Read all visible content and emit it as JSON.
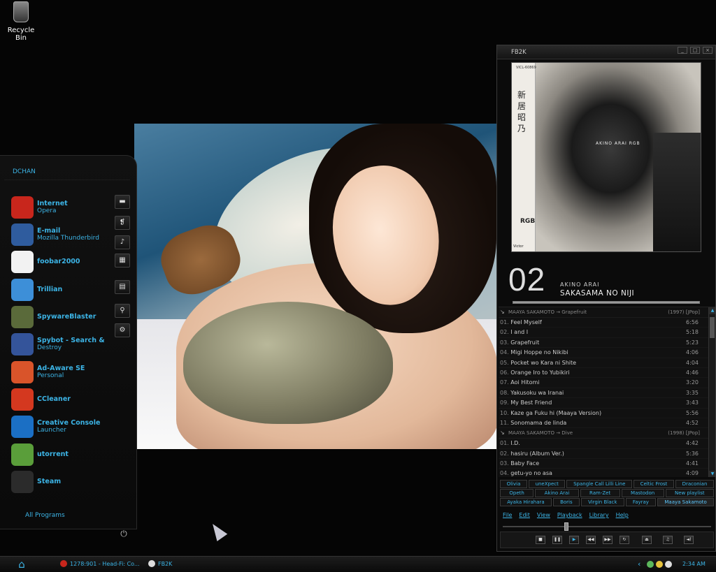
{
  "desktop": {
    "recycle_bin_label": "Recycle Bin",
    "recycle_bin_icon": "recycle-bin-icon"
  },
  "start_menu": {
    "user": "DCHAN",
    "apps": [
      {
        "name": "Internet",
        "sub": "Opera",
        "icon": "opera-icon",
        "color": "#c8261c"
      },
      {
        "name": "E-mail",
        "sub": "Mozilla Thunderbird",
        "icon": "thunderbird-icon",
        "color": "#2f5c9e"
      },
      {
        "name": "foobar2000",
        "sub": "",
        "icon": "foobar2000-icon",
        "color": "#f2f2f2"
      },
      {
        "name": "Trillian",
        "sub": "",
        "icon": "trillian-icon",
        "color": "#3d8fd8"
      },
      {
        "name": "SpywareBlaster",
        "sub": "",
        "icon": "spywareblaster-icon",
        "color": "#5a6a3a"
      },
      {
        "name": "Spybot - Search &",
        "sub": "Destroy",
        "icon": "spybot-icon",
        "color": "#34549a"
      },
      {
        "name": "Ad-Aware SE",
        "sub": "Personal",
        "icon": "adaware-icon",
        "color": "#d9542a"
      },
      {
        "name": "CCleaner",
        "sub": "",
        "icon": "ccleaner-icon",
        "color": "#d4381f"
      },
      {
        "name": "Creative Console",
        "sub": "Launcher",
        "icon": "creative-console-icon",
        "color": "#1b6fc4"
      },
      {
        "name": "utorrent",
        "sub": "",
        "icon": "utorrent-icon",
        "color": "#5a9e3a"
      },
      {
        "name": "Steam",
        "sub": "",
        "icon": "steam-icon",
        "color": "#2b2b2b"
      }
    ],
    "all_programs": "All Programs"
  },
  "fb2k": {
    "window_title": "FB2K",
    "album_art": {
      "catalog": "VICL-60869",
      "kana": "新居昭乃",
      "artist_text": "AKINO ARAI  RGB",
      "rgb": "RGB",
      "label": "Victor"
    },
    "now_playing": {
      "track_number": "02",
      "artist": "AKINO ARAI",
      "title": "SAKASAMA NO NIJI",
      "progress_fraction": 1.0
    },
    "playlist": {
      "groups": [
        {
          "header": "MAAYA SAKAMOTO → Grapefruit",
          "year": "(1997)  [JPop]",
          "tracks": [
            {
              "n": "01.",
              "t": "Feel Myself",
              "d": "6:56"
            },
            {
              "n": "02.",
              "t": "I and I",
              "d": "5:18"
            },
            {
              "n": "03.",
              "t": "Grapefruit",
              "d": "5:23"
            },
            {
              "n": "04.",
              "t": "Migi Hoppe no Nikibi",
              "d": "4:06"
            },
            {
              "n": "05.",
              "t": "Pocket wo Kara ni Shite",
              "d": "4:04"
            },
            {
              "n": "06.",
              "t": "Orange Iro to Yubikiri",
              "d": "4:46"
            },
            {
              "n": "07.",
              "t": "Aoi Hitomi",
              "d": "3:20"
            },
            {
              "n": "08.",
              "t": "Yakusoku wa Iranai",
              "d": "3:35"
            },
            {
              "n": "09.",
              "t": "My Best Friend",
              "d": "3:43"
            },
            {
              "n": "10.",
              "t": "Kaze ga Fuku hi (Maaya Version)",
              "d": "5:56"
            },
            {
              "n": "11.",
              "t": "Sonomama de Iinda",
              "d": "4:52"
            }
          ]
        },
        {
          "header": "MAAYA SAKAMOTO → Dive",
          "year": "(1998)  [JPop]",
          "tracks": [
            {
              "n": "01.",
              "t": "I.D.",
              "d": "4:42"
            },
            {
              "n": "02.",
              "t": "hasiru (Album Ver.)",
              "d": "5:36"
            },
            {
              "n": "03.",
              "t": "Baby Face",
              "d": "4:41"
            },
            {
              "n": "04.",
              "t": "getu-yo no asa",
              "d": "4:09"
            }
          ]
        }
      ]
    },
    "tabs": [
      [
        "Olivia",
        "uneXpect",
        "Spangle Call Lilli Line",
        "Celtic Frost",
        "Draconian"
      ],
      [
        "Opeth",
        "Akino Arai",
        "Ram-Zet",
        "Mastodon",
        "New playlist"
      ],
      [
        "Ayaka Hirahara",
        "Boris",
        "Virgin Black",
        "Fayray",
        "Maaya Sakamoto"
      ]
    ],
    "menu": [
      "File",
      "Edit",
      "View",
      "Playback",
      "Library",
      "Help"
    ],
    "seek_fraction": 0.3,
    "controls": [
      "stop",
      "pause",
      "play",
      "previous",
      "next",
      "random",
      "eject",
      "playlist",
      "volume"
    ]
  },
  "taskbar": {
    "start_icon": "home-icon",
    "tasks": [
      {
        "label": "1278:901 - Head-Fi: Co...",
        "icon": "opera-icon",
        "color": "#c8261c"
      },
      {
        "label": "FB2K",
        "icon": "foobar2000-icon",
        "color": "#dddddd"
      }
    ],
    "tray_arrow": "‹",
    "clock": "2:34 AM"
  }
}
